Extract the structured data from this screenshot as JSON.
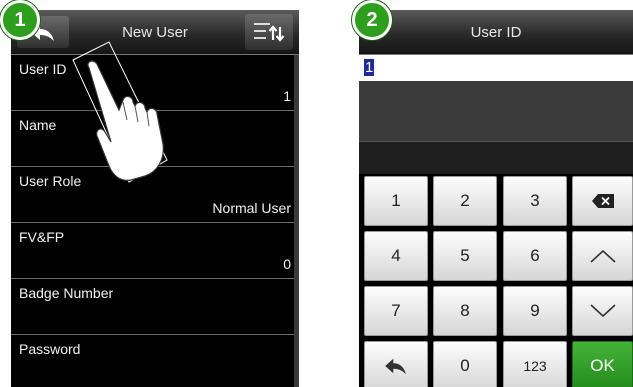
{
  "steps": [
    "1",
    "2"
  ],
  "screen1": {
    "title": "New User",
    "fields": [
      {
        "label": "User ID",
        "value": "1"
      },
      {
        "label": "Name",
        "value": ""
      },
      {
        "label": "User Role",
        "value": "Normal User"
      },
      {
        "label": "FV&FP",
        "value": "0"
      },
      {
        "label": "Badge Number",
        "value": ""
      },
      {
        "label": "Password",
        "value": ""
      }
    ],
    "icons": {
      "back": "back-arrow-icon",
      "sort": "sort-list-icon",
      "pointer": "tapping-hand-icon"
    }
  },
  "screen2": {
    "title": "User ID",
    "input_value": "1",
    "keys": {
      "k1": "1",
      "k2": "2",
      "k3": "3",
      "k4": "4",
      "k5": "5",
      "k6": "6",
      "k7": "7",
      "k8": "8",
      "k9": "9",
      "k0": "0",
      "k123": "123",
      "ok": "OK"
    },
    "icons": {
      "backspace": "backspace-icon",
      "up": "chevron-up-icon",
      "down": "chevron-down-icon",
      "back": "back-arrow-icon"
    }
  },
  "colors": {
    "badge": "#2f9e1e",
    "ok": "#2e9d24",
    "selection": "#1c2a9c"
  }
}
